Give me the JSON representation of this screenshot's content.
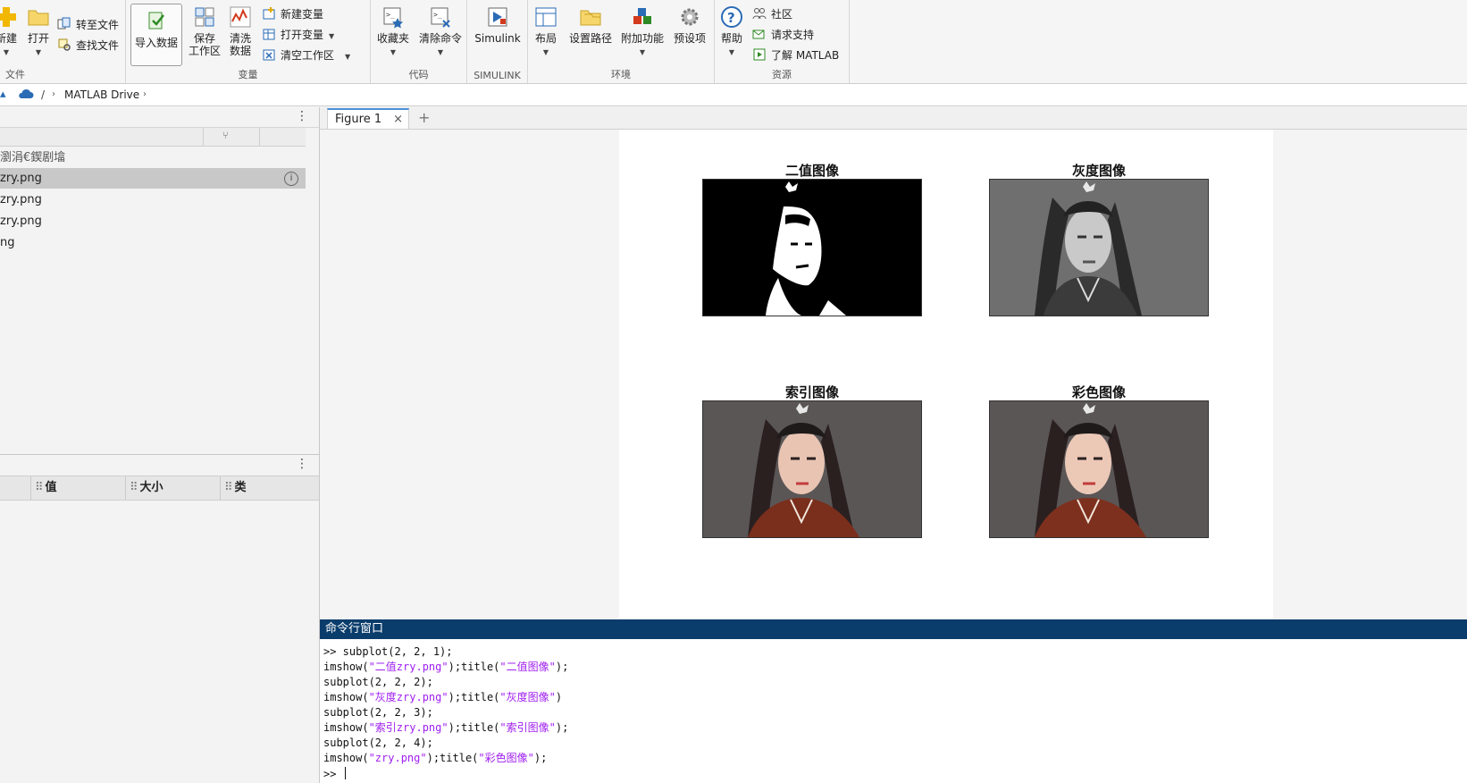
{
  "toolstrip": {
    "file": {
      "label": "文件",
      "new_label": "新建",
      "open_label": "打开",
      "compare_label": "转至文件",
      "find_label": "查找文件"
    },
    "variable": {
      "label": "变量",
      "import_label": "导入数据",
      "save_label": "保存\n工作区",
      "clean_label": "清洗\n数据",
      "new_var_label": "新建变量",
      "open_var_label": "打开变量",
      "clear_ws_label": "清空工作区"
    },
    "code": {
      "label": "代码",
      "favorites_label": "收藏夹",
      "clear_cmds_label": "清除命令"
    },
    "simulink": {
      "label": "SIMULINK",
      "simulink_label": "Simulink"
    },
    "environment": {
      "label": "环境",
      "layout_label": "布局",
      "set_path_label": "设置路径",
      "addons_label": "附加功能",
      "preferences_label": "预设项"
    },
    "resources": {
      "label": "资源",
      "help_label": "帮助",
      "community_label": "社区",
      "support_label": "请求支持",
      "learn_label": "了解 MATLAB"
    }
  },
  "address": {
    "separator": "/",
    "location": "MATLAB Drive"
  },
  "files_panel": {
    "folder_label": "瀏涓€鍥剧墖",
    "files": [
      {
        "name": "zry.png",
        "selected": true
      },
      {
        "name": "zry.png",
        "selected": false
      },
      {
        "name": "zry.png",
        "selected": false
      },
      {
        "name": "ng",
        "selected": false
      }
    ]
  },
  "workspace": {
    "columns": [
      "值",
      "大小",
      "类"
    ]
  },
  "figure": {
    "tab_label": "Figure 1",
    "subplots": [
      {
        "title": "二值图像",
        "kind": "binary"
      },
      {
        "title": "灰度图像",
        "kind": "gray"
      },
      {
        "title": "索引图像",
        "kind": "color"
      },
      {
        "title": "彩色图像",
        "kind": "color"
      }
    ]
  },
  "command_window": {
    "title": "命令行窗口",
    "lines": [
      [
        {
          "t": ">> subplot(2, 2, 1);"
        }
      ],
      [
        {
          "t": "imshow("
        },
        {
          "t": "\"二值zry.png\"",
          "s": 1
        },
        {
          "t": ");title("
        },
        {
          "t": "\"二值图像\"",
          "s": 1
        },
        {
          "t": ");"
        }
      ],
      [
        {
          "t": "subplot(2, 2, 2);"
        }
      ],
      [
        {
          "t": "imshow("
        },
        {
          "t": "\"灰度zry.png\"",
          "s": 1
        },
        {
          "t": ");title("
        },
        {
          "t": "\"灰度图像\"",
          "s": 1
        },
        {
          "t": ")"
        }
      ],
      [
        {
          "t": "subplot(2, 2, 3);"
        }
      ],
      [
        {
          "t": "imshow("
        },
        {
          "t": "\"索引zry.png\"",
          "s": 1
        },
        {
          "t": ");title("
        },
        {
          "t": "\"索引图像\"",
          "s": 1
        },
        {
          "t": ");"
        }
      ],
      [
        {
          "t": "subplot(2, 2, 4);"
        }
      ],
      [
        {
          "t": "imshow("
        },
        {
          "t": "\"zry.png\"",
          "s": 1
        },
        {
          "t": ");title("
        },
        {
          "t": "\"彩色图像\"",
          "s": 1
        },
        {
          "t": ");"
        }
      ]
    ],
    "prompt": ">> "
  },
  "colors": {
    "command_title_bg": "#0a3d6b",
    "string_color": "#a020f0",
    "tab_accent": "#4a90d9"
  }
}
